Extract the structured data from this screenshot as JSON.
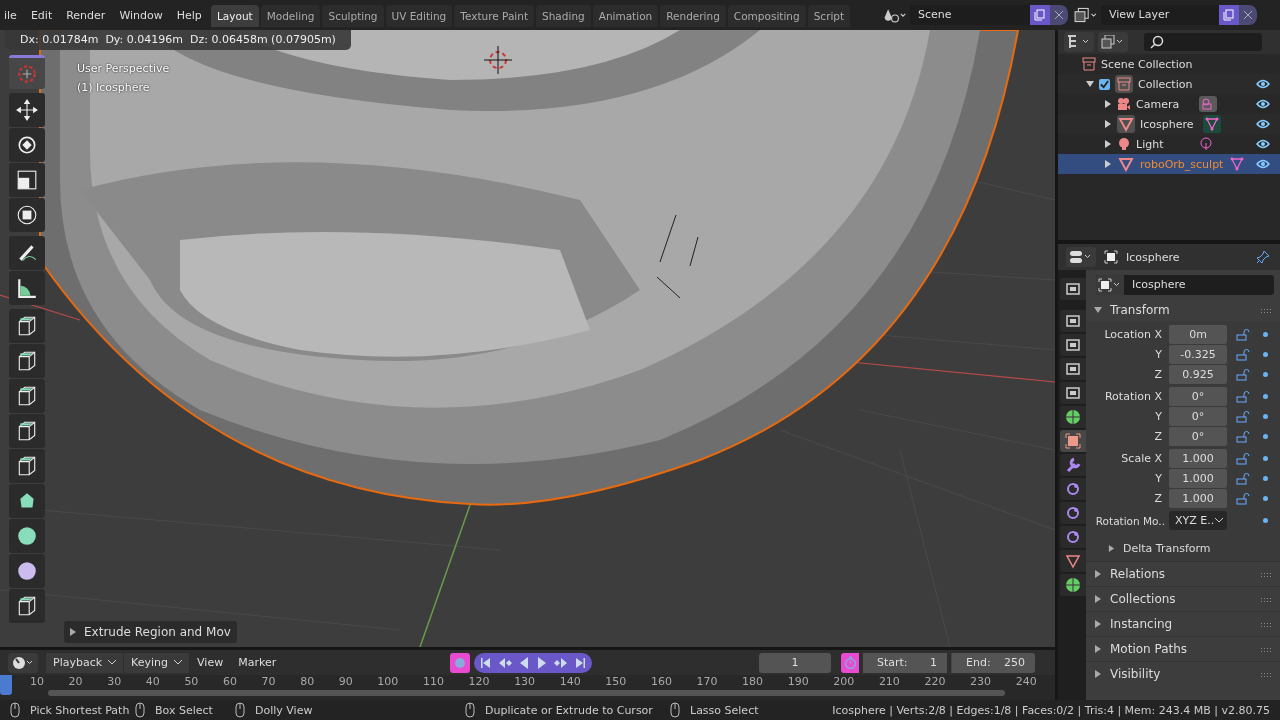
{
  "menu": [
    "ile",
    "Edit",
    "Render",
    "Window",
    "Help"
  ],
  "workspaces": [
    {
      "label": "Layout",
      "selected": true
    },
    {
      "label": "Modeling",
      "selected": false
    },
    {
      "label": "Sculpting",
      "selected": false
    },
    {
      "label": "UV Editing",
      "selected": false
    },
    {
      "label": "Texture Paint",
      "selected": false
    },
    {
      "label": "Shading",
      "selected": false
    },
    {
      "label": "Animation",
      "selected": false
    },
    {
      "label": "Rendering",
      "selected": false
    },
    {
      "label": "Compositing",
      "selected": false
    },
    {
      "label": "Script",
      "selected": false
    }
  ],
  "scene": {
    "name": "Scene"
  },
  "view_layer": {
    "name": "View Layer"
  },
  "viewport": {
    "measurement": "Dx: 0.01784m  Dy: 0.04196m  Dz: 0.06458m (0.07905m)",
    "view_name": "User Perspective",
    "object_label": "(1) Icosphere",
    "last_operator": "Extrude Region and Mov",
    "tools": [
      {
        "kind": "cursor",
        "selected": true
      },
      {
        "kind": "move",
        "selected": false
      },
      {
        "kind": "rotate",
        "selected": false
      },
      {
        "kind": "scale",
        "selected": false
      },
      {
        "kind": "transform",
        "selected": false
      },
      {
        "kind": "annotate",
        "selected": false
      },
      {
        "kind": "measure",
        "selected": false
      },
      {
        "kind": "extrude",
        "selected": false
      },
      {
        "kind": "inset",
        "selected": false
      },
      {
        "kind": "bevel",
        "selected": false
      },
      {
        "kind": "loopcut",
        "selected": false
      },
      {
        "kind": "knife",
        "selected": false
      },
      {
        "kind": "polybuild",
        "selected": false
      },
      {
        "kind": "spin",
        "selected": false
      },
      {
        "kind": "smooth",
        "selected": false
      },
      {
        "kind": "shrink",
        "selected": false
      }
    ]
  },
  "outliner": {
    "root": {
      "label": "Scene Collection",
      "children": [
        {
          "label": "Collection",
          "checked": true,
          "expanded": true,
          "visible": true,
          "selected": false,
          "children": [
            {
              "label": "Camera",
              "kind": "camera",
              "visible": true,
              "selected": false
            },
            {
              "label": "Icosphere",
              "kind": "mesh",
              "visible": true,
              "selected": false
            },
            {
              "label": "Light",
              "kind": "light",
              "visible": true,
              "selected": false
            },
            {
              "label": "roboOrb_sculpt",
              "kind": "mesh",
              "visible": true,
              "selected": true
            }
          ]
        }
      ]
    }
  },
  "properties": {
    "title": "Icosphere",
    "object_name": "Icosphere",
    "tabs": [
      {
        "kind": "tool",
        "selected": false
      },
      {
        "kind": "render",
        "selected": false
      },
      {
        "kind": "output",
        "selected": false
      },
      {
        "kind": "view_layer",
        "selected": false
      },
      {
        "kind": "scene",
        "selected": false
      },
      {
        "kind": "world",
        "selected": false
      },
      {
        "kind": "object",
        "selected": true
      },
      {
        "kind": "modifier",
        "selected": false
      },
      {
        "kind": "particles",
        "selected": false
      },
      {
        "kind": "physics",
        "selected": false
      },
      {
        "kind": "constraints",
        "selected": false
      },
      {
        "kind": "data",
        "selected": false
      },
      {
        "kind": "material",
        "selected": false
      }
    ],
    "transform": {
      "title": "Transform",
      "expanded": true,
      "groups": [
        {
          "rows": [
            {
              "label": "Location X",
              "value": "0m",
              "locked": false
            },
            {
              "label": "Y",
              "value": "-0.325",
              "locked": false
            },
            {
              "label": "Z",
              "value": "0.925",
              "locked": false
            }
          ]
        },
        {
          "rows": [
            {
              "label": "Rotation X",
              "value": "0°",
              "locked": false
            },
            {
              "label": "Y",
              "value": "0°",
              "locked": false
            },
            {
              "label": "Z",
              "value": "0°",
              "locked": false
            }
          ]
        },
        {
          "rows": [
            {
              "label": "Scale X",
              "value": "1.000",
              "locked": false
            },
            {
              "label": "Y",
              "value": "1.000",
              "locked": false
            },
            {
              "label": "Z",
              "value": "1.000",
              "locked": false
            }
          ]
        }
      ],
      "rotation_mode_label": "Rotation Mo..",
      "rotation_mode": "XYZ E..",
      "delta": {
        "title": "Delta Transform",
        "expanded": false
      }
    },
    "panels": [
      {
        "title": "Relations",
        "expanded": false
      },
      {
        "title": "Collections",
        "expanded": false
      },
      {
        "title": "Instancing",
        "expanded": false
      },
      {
        "title": "Motion Paths",
        "expanded": false
      },
      {
        "title": "Visibility",
        "expanded": false
      }
    ]
  },
  "timeline": {
    "menus": [
      {
        "label": "Playback",
        "dropdown": true
      },
      {
        "label": "Keying",
        "dropdown": true
      },
      {
        "label": "View",
        "dropdown": false
      },
      {
        "label": "Marker",
        "dropdown": false
      }
    ],
    "auto_keying": true,
    "current_frame": "1",
    "preview_range": true,
    "start_label": "Start:",
    "start": "1",
    "end_label": "End:",
    "end": "250",
    "ruler": [
      "10",
      "20",
      "30",
      "40",
      "50",
      "60",
      "70",
      "80",
      "90",
      "100",
      "110",
      "120",
      "130",
      "140",
      "150",
      "160",
      "170",
      "180",
      "190",
      "200",
      "210",
      "220",
      "230",
      "240"
    ]
  },
  "status_bar": {
    "hints": [
      {
        "text": "Pick Shortest Path"
      },
      {
        "text": "Box Select"
      },
      {
        "text": "Dolly View"
      },
      {
        "text": "Duplicate or Extrude to Cursor"
      },
      {
        "text": "Lasso Select"
      }
    ],
    "stats": "Icosphere | Verts:2/8 | Edges:1/8 | Faces:0/2 | Tris:4 | Mem: 243.4 MB | v2.80.75"
  }
}
